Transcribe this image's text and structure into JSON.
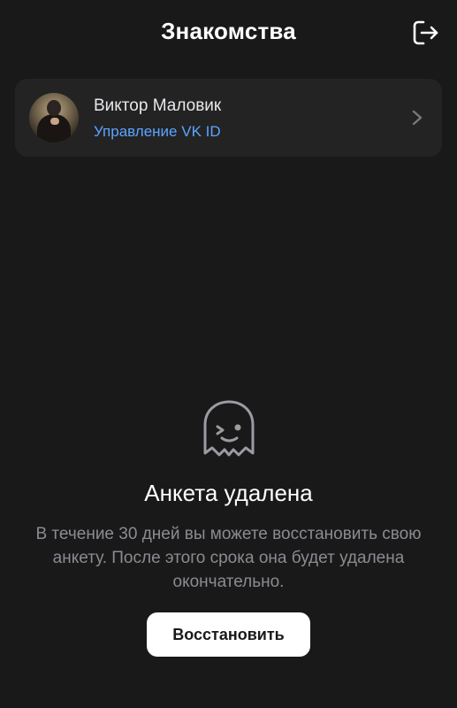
{
  "header": {
    "title": "Знакомства",
    "logout_icon": "logout-icon"
  },
  "profile": {
    "name": "Виктор Маловик",
    "link": "Управление VK ID",
    "avatar_icon": "user-avatar",
    "chevron_icon": "chevron-right-icon"
  },
  "empty_state": {
    "icon": "ghost-wink-icon",
    "title": "Анкета удалена",
    "description": "В течение 30 дней вы можете восстановить свою анкету. После этого срока она будет удалена окончательно.",
    "button_label": "Восстановить"
  },
  "colors": {
    "background": "#19191a",
    "card": "#232324",
    "accent_link": "#5aa5ff",
    "muted_text": "#8a8c91",
    "button_bg": "#ffffff"
  }
}
